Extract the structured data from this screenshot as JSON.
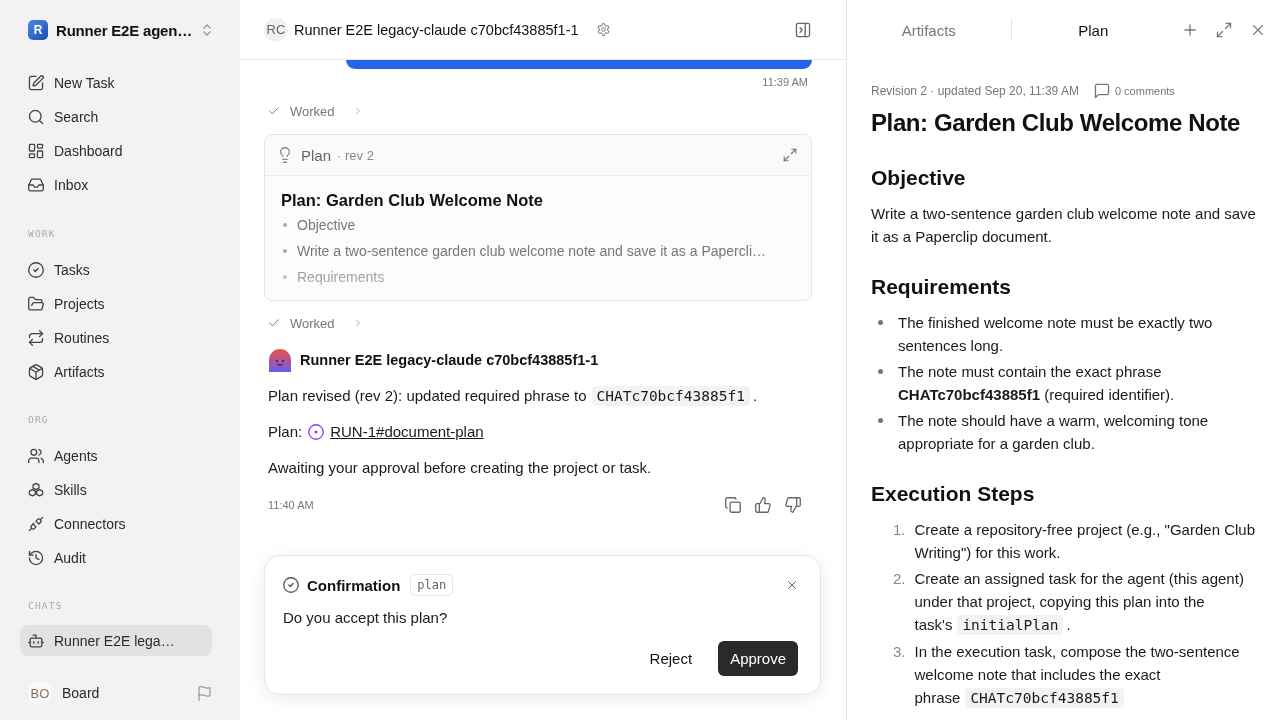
{
  "sidebar": {
    "workspace": {
      "initial": "R",
      "name": "Runner E2E agen…"
    },
    "nav": [
      {
        "label": "New Task",
        "selected": false
      },
      {
        "label": "Search",
        "selected": false
      },
      {
        "label": "Dashboard",
        "selected": false
      },
      {
        "label": "Inbox",
        "selected": false
      }
    ],
    "sections": [
      {
        "heading": "WORK",
        "items": [
          {
            "label": "Tasks",
            "selected": false
          },
          {
            "label": "Projects",
            "selected": false
          },
          {
            "label": "Routines",
            "selected": false
          },
          {
            "label": "Artifacts",
            "selected": false
          }
        ]
      },
      {
        "heading": "ORG",
        "items": [
          {
            "label": "Agents",
            "selected": false
          },
          {
            "label": "Skills",
            "selected": false
          },
          {
            "label": "Connectors",
            "selected": false
          },
          {
            "label": "Audit",
            "selected": false
          }
        ]
      },
      {
        "heading": "CHATS",
        "items": [
          {
            "label": "Runner E2E lega…",
            "selected": true
          }
        ]
      }
    ],
    "user": {
      "initials": "BO",
      "name": "Board"
    }
  },
  "chat": {
    "header": {
      "initials": "RC",
      "title": "Runner E2E legacy-claude c70bcf43885f1-1"
    },
    "timeline": [
      {
        "kind": "user_message",
        "time": "11:39 AM"
      },
      {
        "kind": "worked",
        "label": "Worked"
      },
      {
        "kind": "plan_card",
        "label": "Plan",
        "revision": "· rev 2",
        "title": "Plan: Garden Club Welcome Note",
        "items": [
          "Objective",
          "Write a two-sentence garden club welcome note and save it as a Papercli…",
          "Requirements"
        ]
      },
      {
        "kind": "worked",
        "label": "Worked"
      },
      {
        "kind": "agent_message",
        "author": "Runner E2E legacy-claude c70bcf43885f1-1",
        "paragraphs": [
          {
            "kind": "text",
            "segments": [
              {
                "kind": "text",
                "text": "Plan revised (rev 2): updated required phrase to"
              },
              {
                "kind": "code",
                "text": "CHATc70bcf43885f1"
              },
              {
                "kind": "text",
                "text": "."
              }
            ]
          },
          {
            "kind": "link",
            "label": "Plan:",
            "link": "RUN-1#document-plan"
          },
          {
            "kind": "text",
            "segments": [
              {
                "kind": "text",
                "text": "Awaiting your approval before creating the project or task."
              }
            ]
          }
        ],
        "time": "11:40 AM"
      }
    ],
    "confirmation": {
      "title": "Confirmation",
      "tag": "plan",
      "question": "Do you accept this plan?",
      "buttons": [
        {
          "label": "Reject",
          "kind": "secondary"
        },
        {
          "label": "Approve",
          "kind": "primary"
        }
      ]
    }
  },
  "panel": {
    "tabs": [
      {
        "label": "Artifacts",
        "selected": false
      },
      {
        "label": "Plan",
        "selected": true
      }
    ],
    "meta": "Revision 2 · updated Sep 20, 11:39 AM",
    "comments": "0 comments",
    "title": "Plan: Garden Club Welcome Note",
    "sections": [
      {
        "heading": "Objective",
        "kind": "paragraph",
        "text": "Write a two-sentence garden club welcome note and save it as a Paperclip document."
      },
      {
        "heading": "Requirements",
        "kind": "bullets",
        "items": [
          "The finished welcome note must be exactly two sentences long.",
          "The note must contain the exact phrase **CHATc70bcf43885f1** (required identifier).",
          "The note should have a warm, welcoming tone appropriate for a garden club."
        ]
      },
      {
        "heading": "Execution Steps",
        "kind": "numbered",
        "items": [
          {
            "number": "1.",
            "text": "Create a repository-free project (e.g., \"Garden Club Writing\") for this work."
          },
          {
            "number": "2.",
            "text": [
              {
                "kind": "text",
                "text": "Create an assigned task for the agent (this agent) under that project, copying this plan into the task's"
              },
              {
                "kind": "code",
                "text": "initialPlan"
              },
              {
                "kind": "text",
                "text": "."
              }
            ]
          },
          {
            "number": "3.",
            "text": [
              {
                "kind": "text",
                "text": "In the execution task, compose the two-sentence welcome note that includes the exact phrase"
              },
              {
                "kind": "code",
                "text": "CHATc70bcf43885f1"
              }
            ]
          }
        ]
      }
    ]
  }
}
